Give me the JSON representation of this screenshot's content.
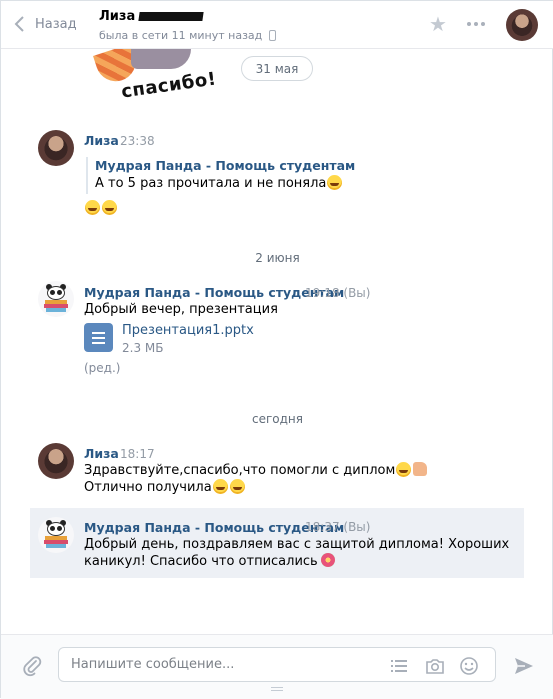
{
  "header": {
    "back_label": "Назад",
    "peer_name": "Лиза",
    "peer_status": "была в сети 11 минут назад"
  },
  "sticker": {
    "text": "спасибо!"
  },
  "dates": {
    "pill": "31 мая",
    "june2": "2 июня",
    "today": "сегодня"
  },
  "messages": [
    {
      "author": "Лиза",
      "time": "23:38",
      "quote_author": "Мудрая Панда - Помощь студентам",
      "quote_text": "А то 5 раз прочитала и не поняла"
    },
    {
      "author": "Мудрая Панда - Помощь студентам",
      "time": "19:18 (Вы)",
      "text": "Добрый вечер, презентация",
      "doc_name": "Презентация1.pptx",
      "doc_size": "2.3 МБ",
      "edited": "(ред.)"
    },
    {
      "author": "Лиза",
      "time": "18:17",
      "line1": "Здравствуйте,спасибо,что помогли с диплом",
      "line2": "Отлично получила"
    },
    {
      "author": "Мудрая Панда - Помощь студентам",
      "time": "18:37 (Вы)",
      "line1": "Добрый день, поздравляем вас с защитой диплома! Хороших",
      "line2": "каникул! Спасибо что отписались"
    }
  ],
  "composer": {
    "placeholder": "Напишите сообщение..."
  },
  "icons": [
    "chevron-left-icon",
    "phone-icon",
    "star-icon",
    "more-icon",
    "paperclip-icon",
    "list-icon",
    "camera-icon",
    "smile-icon",
    "send-icon",
    "document-icon"
  ],
  "colors": {
    "link": "#2a5885",
    "muted": "#828a99",
    "highlight": "#edf0f5"
  }
}
